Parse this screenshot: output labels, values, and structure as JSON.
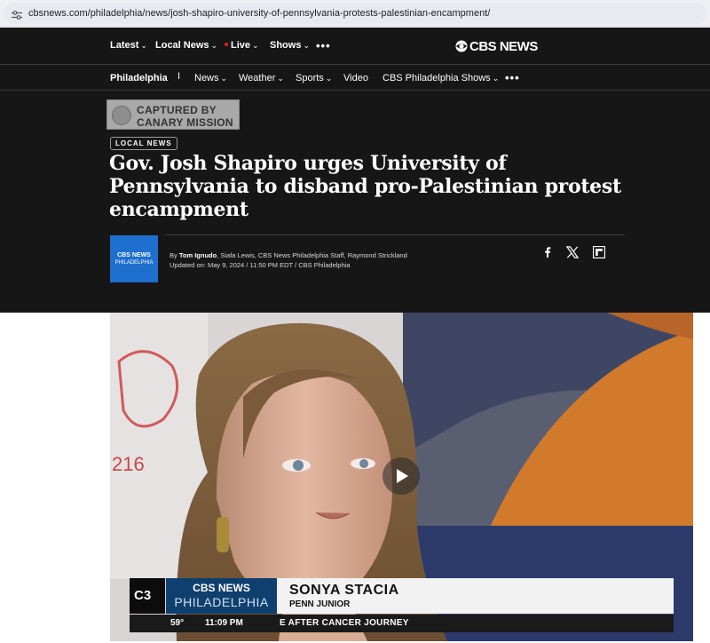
{
  "browser": {
    "url": "cbsnews.com/philadelphia/news/josh-shapiro-university-of-pennsylvania-protests-palestinian-encampment/"
  },
  "top_nav": {
    "items": [
      "Latest",
      "Local News",
      "Live",
      "Shows"
    ],
    "logo_text": "CBS NEWS"
  },
  "sub_nav": {
    "station": "Philadelphia",
    "separator": "I",
    "items": [
      "News",
      "Weather",
      "Sports",
      "Video",
      "CBS Philadelphia Shows"
    ]
  },
  "watermark": {
    "line1": "CAPTURED BY",
    "line2": "CANARY MISSION"
  },
  "article": {
    "tag": "LOCAL NEWS",
    "headline": "Gov. Josh Shapiro urges University of Pennsylvania to disband pro-Palestinian protest encampment",
    "thumb_line1": "CBS NEWS",
    "thumb_line2": "PHILADELPHIA",
    "by_prefix": "By ",
    "author": "Tom Ignudo",
    "other_authors": ", Siafa Lewis, CBS News Philadelphia Staff, Raymond Strickland",
    "updated": "Updated on: May 9, 2024 / 11:50 PM EDT / CBS Philadelphia"
  },
  "video": {
    "badge": "C3",
    "brand_line1": "CBS NEWS",
    "brand_line2": "PHILADELPHIA",
    "name": "SONYA STACIA",
    "role": "PENN JUNIOR",
    "temperature": "59°",
    "time": "11:09 PM",
    "crawl": "E AFTER CANCER JOURNEY"
  },
  "icons": [
    "tune-icon",
    "cbs-eye-icon",
    "facebook-icon",
    "x-icon",
    "flipboard-icon",
    "play-icon"
  ]
}
